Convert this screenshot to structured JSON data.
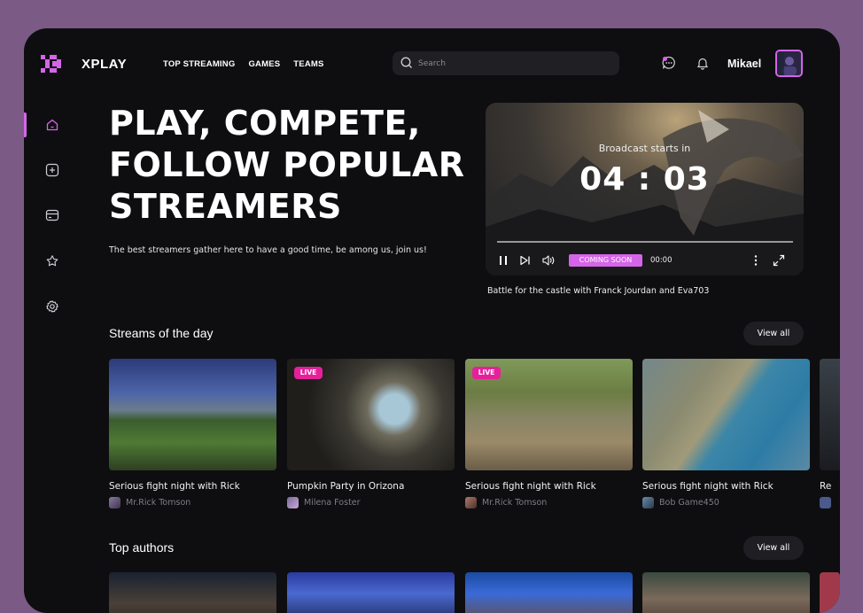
{
  "header": {
    "brand": "XPLAY",
    "nav": [
      "TOP STREAMING",
      "GAMES",
      "TEAMS"
    ],
    "search_placeholder": "Search",
    "username": "Mikael"
  },
  "sidebar": {
    "items": [
      {
        "icon": "home-icon",
        "active": true
      },
      {
        "icon": "add-square-icon",
        "active": false
      },
      {
        "icon": "card-icon",
        "active": false
      },
      {
        "icon": "star-badge-icon",
        "active": false
      },
      {
        "icon": "settings-icon",
        "active": false
      }
    ]
  },
  "hero": {
    "title": "PLAY, COMPETE, FOLLOW POPULAR STREAMERS",
    "subtitle": "The best streamers gather here to have a good time, be among us, join us!"
  },
  "player": {
    "broadcast_label": "Broadcast starts in",
    "countdown": "04 : 03",
    "status_badge": "COMING SOON",
    "time": "00:00",
    "caption": "Battle for the castle with Franck Jourdan and Eva703"
  },
  "streams": {
    "title": "Streams of the day",
    "view_all": "View all",
    "cards": [
      {
        "title": "Serious fight night with Rick",
        "author": "Mr.Rick Tomson",
        "live": false
      },
      {
        "title": "Pumpkin Party in Orizona",
        "author": "Milena Foster",
        "live": true,
        "live_label": "LIVE"
      },
      {
        "title": "Serious fight night with Rick",
        "author": "Mr.Rick Tomson",
        "live": true,
        "live_label": "LIVE"
      },
      {
        "title": "Serious fight night with Rick",
        "author": "Bob Game450",
        "live": false
      },
      {
        "title": "Re",
        "author": "",
        "live": false
      }
    ]
  },
  "authors": {
    "title": "Top authors",
    "view_all": "View all"
  },
  "colors": {
    "accent": "#d565e8",
    "live": "#e6209b",
    "background": "#0e0e11",
    "frame": "#7b5a86"
  }
}
